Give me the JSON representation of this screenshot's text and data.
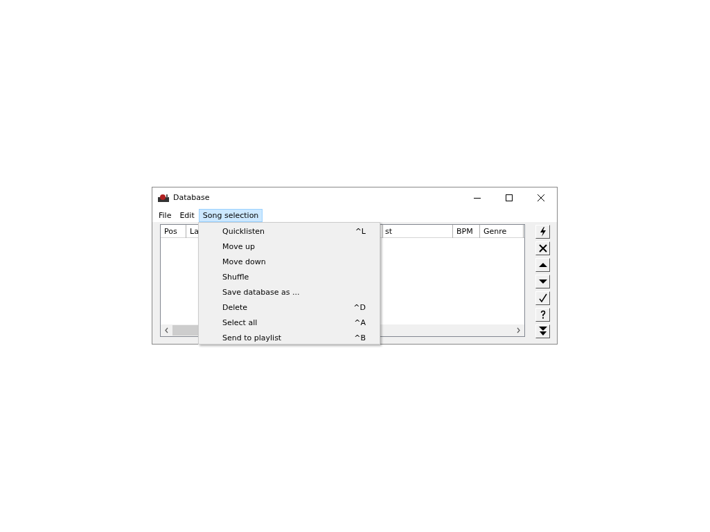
{
  "window": {
    "title": "Database"
  },
  "menubar": [
    {
      "label": "File",
      "selected": false
    },
    {
      "label": "Edit",
      "selected": false
    },
    {
      "label": "Song selection",
      "selected": true
    }
  ],
  "table": {
    "columns": [
      "Pos",
      "La",
      "st",
      "BPM",
      "Genre"
    ]
  },
  "menu": {
    "items": [
      {
        "label": "Quicklisten",
        "shortcut": "^L"
      },
      {
        "label": "Move up"
      },
      {
        "label": "Move down"
      },
      {
        "label": "Shuffle"
      },
      {
        "label": "Save database as ..."
      },
      {
        "label": "Delete",
        "shortcut": "^D"
      },
      {
        "label": "Select all",
        "shortcut": "^A"
      },
      {
        "label": "Send to playlist",
        "shortcut": "^B"
      }
    ]
  }
}
